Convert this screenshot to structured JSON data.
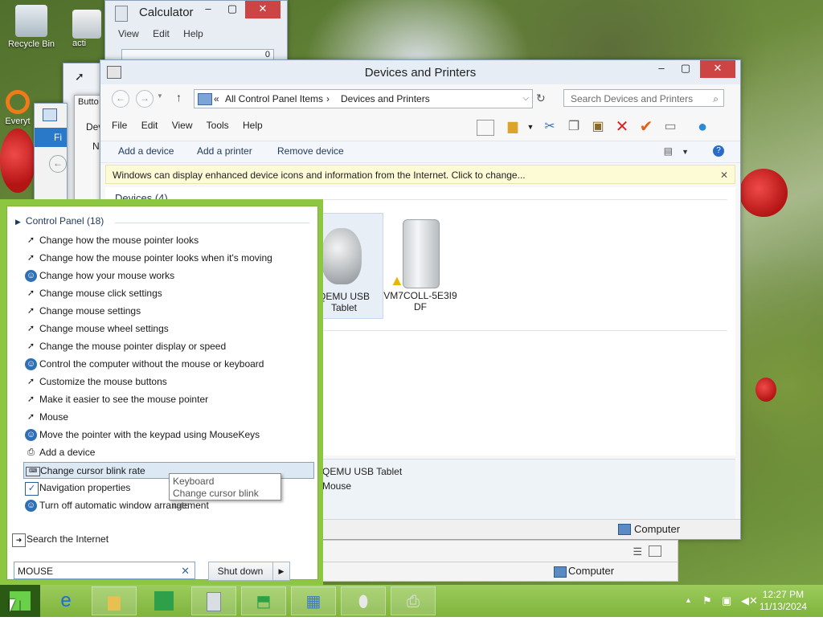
{
  "desktop": {
    "icons": [
      {
        "label": "Recycle Bin"
      },
      {
        "label": "acti"
      },
      {
        "label": "Everyt"
      }
    ]
  },
  "calculator": {
    "title": "Calculator",
    "menu": [
      "View",
      "Edit",
      "Help"
    ],
    "display": "0"
  },
  "bg_window": {
    "button_label": "Butto",
    "text1": "Dev",
    "text2": "N",
    "tab": "Fi"
  },
  "devices_window": {
    "title": "Devices and Printers",
    "address": {
      "root": "All Control Panel Items",
      "current": "Devices and Printers"
    },
    "search_placeholder": "Search Devices and Printers",
    "menu": [
      "File",
      "Edit",
      "View",
      "Tools",
      "Help"
    ],
    "commands": [
      "Add a device",
      "Add a printer",
      "Remove device"
    ],
    "infobar": "Windows can display enhanced device icons and information from the Internet. Click to change...",
    "section": "Devices (4)",
    "devices": [
      {
        "label": "QEMU USB Tablet",
        "selected": true
      },
      {
        "label": "VM7COLL-5E3I9DF",
        "warning": true
      }
    ],
    "detail": {
      "name": "QEMU USB Tablet",
      "category": "Mouse"
    },
    "status_location": "Computer"
  },
  "bg_status": {
    "location": "Computer"
  },
  "start_search": {
    "group_header": "Control Panel (18)",
    "results": [
      {
        "label": "Change how the mouse pointer looks",
        "icon": "mouse-pointer-icon"
      },
      {
        "label": "Change how the mouse pointer looks when it's moving",
        "icon": "mouse-pointer-icon"
      },
      {
        "label": "Change how your mouse works",
        "icon": "ease-of-access-icon"
      },
      {
        "label": "Change mouse click settings",
        "icon": "mouse-pointer-icon"
      },
      {
        "label": "Change mouse settings",
        "icon": "mouse-pointer-icon"
      },
      {
        "label": "Change mouse wheel settings",
        "icon": "mouse-pointer-icon"
      },
      {
        "label": "Change the mouse pointer display or speed",
        "icon": "mouse-pointer-icon"
      },
      {
        "label": "Control the computer without the mouse or keyboard",
        "icon": "ease-of-access-icon"
      },
      {
        "label": "Customize the mouse buttons",
        "icon": "mouse-pointer-icon"
      },
      {
        "label": "Make it easier to see the mouse pointer",
        "icon": "mouse-pointer-icon"
      },
      {
        "label": "Mouse",
        "icon": "mouse-pointer-icon"
      },
      {
        "label": "Move the pointer with the keypad using MouseKeys",
        "icon": "ease-of-access-icon"
      },
      {
        "label": "Add a device",
        "icon": "devices-icon"
      },
      {
        "label": "Change cursor blink rate",
        "icon": "keyboard-icon",
        "highlighted": true
      },
      {
        "label": "Navigation properties",
        "icon": "checkbox-icon"
      },
      {
        "label": "Turn off automatic window arrangement",
        "icon": "ease-of-access-icon"
      }
    ],
    "search_internet": "Search the Internet",
    "query": "MOUSE",
    "shutdown_label": "Shut down",
    "tooltip": {
      "title": "Keyboard",
      "text": "Change cursor blink rate"
    }
  },
  "taskbar": {
    "time": "12:27 PM",
    "date": "11/13/2024"
  },
  "colors": {
    "start_menu_frame": "#8dc640",
    "taskbar": "#8cc04c",
    "infobar": "#fdfbd5",
    "highlight": "#dde8f5"
  }
}
